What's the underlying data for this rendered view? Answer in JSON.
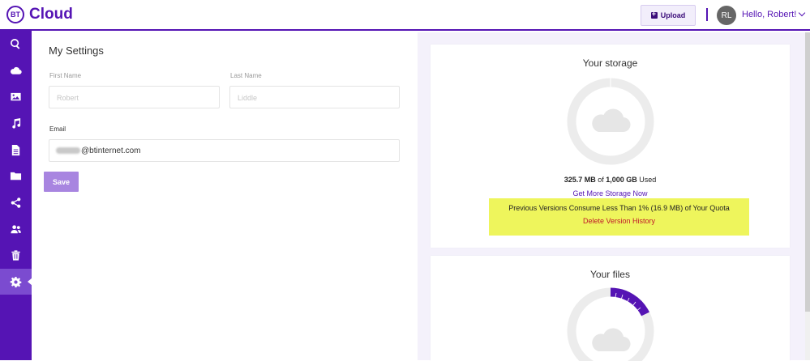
{
  "app": {
    "logo_badge": "BT",
    "logo_text": "Cloud"
  },
  "header": {
    "upload_label": "Upload",
    "avatar_initials": "RL",
    "greeting": "Hello, Robert!"
  },
  "sidebar": {
    "items": [
      {
        "icon": "search-icon"
      },
      {
        "icon": "cloud-icon"
      },
      {
        "icon": "image-icon"
      },
      {
        "icon": "music-icon"
      },
      {
        "icon": "document-icon"
      },
      {
        "icon": "folder-icon"
      },
      {
        "icon": "share-icon"
      },
      {
        "icon": "contacts-icon"
      },
      {
        "icon": "trash-icon"
      },
      {
        "icon": "gear-icon",
        "active": true
      }
    ]
  },
  "settings": {
    "title": "My Settings",
    "first_name_label": "First Name",
    "first_name_value": "Robert",
    "last_name_label": "Last Name",
    "last_name_value": "Liddle",
    "email_label": "Email",
    "email_domain": "@btinternet.com",
    "save_label": "Save"
  },
  "storage": {
    "title": "Your storage",
    "used_amount": "325.7 MB",
    "of_text": " of ",
    "total_amount": "1,000 GB",
    "used_suffix": " Used",
    "more_link": "Get More Storage Now",
    "notice_text": "Previous Versions Consume Less Than 1% (16.9 MB) of Your Quota",
    "notice_link": "Delete Version History"
  },
  "files": {
    "title": "Your files"
  },
  "colors": {
    "brand": "#5514b4",
    "notice_bg": "#eef55c",
    "link_red": "#c0182a"
  }
}
